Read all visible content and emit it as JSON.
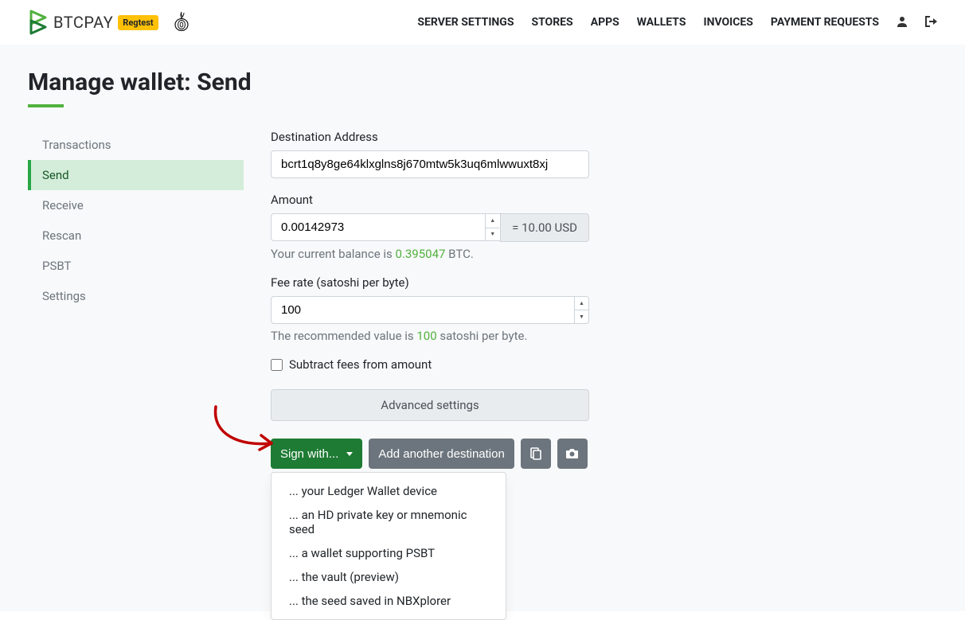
{
  "brand": {
    "name": "BTCPAY",
    "badge": "Regtest"
  },
  "nav": {
    "server_settings": "SERVER SETTINGS",
    "stores": "STORES",
    "apps": "APPS",
    "wallets": "WALLETS",
    "invoices": "INVOICES",
    "payment_requests": "PAYMENT REQUESTS"
  },
  "page": {
    "title": "Manage wallet: Send"
  },
  "sidenav": {
    "transactions": "Transactions",
    "send": "Send",
    "receive": "Receive",
    "rescan": "Rescan",
    "psbt": "PSBT",
    "settings": "Settings"
  },
  "form": {
    "dest_label": "Destination Address",
    "dest_value": "bcrt1q8y8ge64klxglns8j670mtw5k3uq6mlwwuxt8xj",
    "amount_label": "Amount",
    "amount_value": "0.00142973",
    "fiat_text": "= 10.00 USD",
    "balance_prefix": "Your current balance is ",
    "balance_value": "0.395047",
    "balance_suffix": " BTC.",
    "fee_label": "Fee rate (satoshi per byte)",
    "fee_value": "100",
    "fee_helper_prefix": "The recommended value is ",
    "fee_helper_value": "100",
    "fee_helper_suffix": " satoshi per byte.",
    "subtract_label": "Subtract fees from amount",
    "advanced": "Advanced settings",
    "sign_with": "Sign with...",
    "add_dest": "Add another destination"
  },
  "dropdown": {
    "ledger": "... your Ledger Wallet device",
    "hdkey": "... an HD private key or mnemonic seed",
    "psbt": "... a wallet supporting PSBT",
    "vault": "... the vault (preview)",
    "nbx": "... the seed saved in NBXplorer"
  }
}
